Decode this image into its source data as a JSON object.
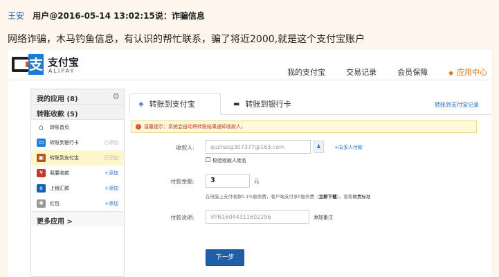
{
  "post": {
    "author": "王安",
    "meta": "用户@2016-05-14 13:02:15说：诈骗信息",
    "body": "网络诈骗，木马钓鱼信息，有认识的帮忙联系，骗了将近2000,就是这个支付宝账户"
  },
  "alipay": {
    "logo_name": "支付宝",
    "logo_sub": "ALIPAY",
    "logo_glyph": "支",
    "nav": [
      "我的支付宝",
      "交易记录",
      "会员保障",
      "应用中心"
    ],
    "sidebar": {
      "title": "我的应用 (8)",
      "section": "转账收款 (5)",
      "items": [
        {
          "label": "转账首页",
          "icon": "home-icon",
          "tag": ""
        },
        {
          "label": "转账到银行卡",
          "icon": "bank-card-icon",
          "tag": "已添加"
        },
        {
          "label": "转账到支付宝",
          "icon": "alipay-transfer-icon",
          "tag": "已添加"
        },
        {
          "label": "我要收款",
          "icon": "collect-icon",
          "tag": "+添加"
        },
        {
          "label": "上银汇款",
          "icon": "remit-icon",
          "tag": "+添加"
        },
        {
          "label": "红包",
          "icon": "red-packet-icon",
          "tag": "+添加"
        }
      ],
      "more": "更多应用 >"
    },
    "tabs": {
      "active": "转账到支付宝",
      "second": "转账到银行卡",
      "link": "转账到支付宝记录"
    },
    "tip": "温馨提示：系统会自动将转账结果通知收款人。",
    "form": {
      "payee_label": "收款人:",
      "payee_value": "quzhasg307377@163.com",
      "multi_link": "+向多人付款",
      "verify_name": "校验收款人姓名",
      "amount_label": "付款金额:",
      "amount_value": "3",
      "unit": "元",
      "fee_note_a": "在电脑上支付收款0.1%服务费，客户端支付享0服务费（",
      "fee_note_link": "立即下载",
      "fee_note_b": "）。查看",
      "fee_note_link2": "收费标准",
      "memo_label": "付款说明:",
      "memo_value": "VPN16044311602296",
      "memo_add": "添加备注",
      "next": "下一步"
    }
  }
}
